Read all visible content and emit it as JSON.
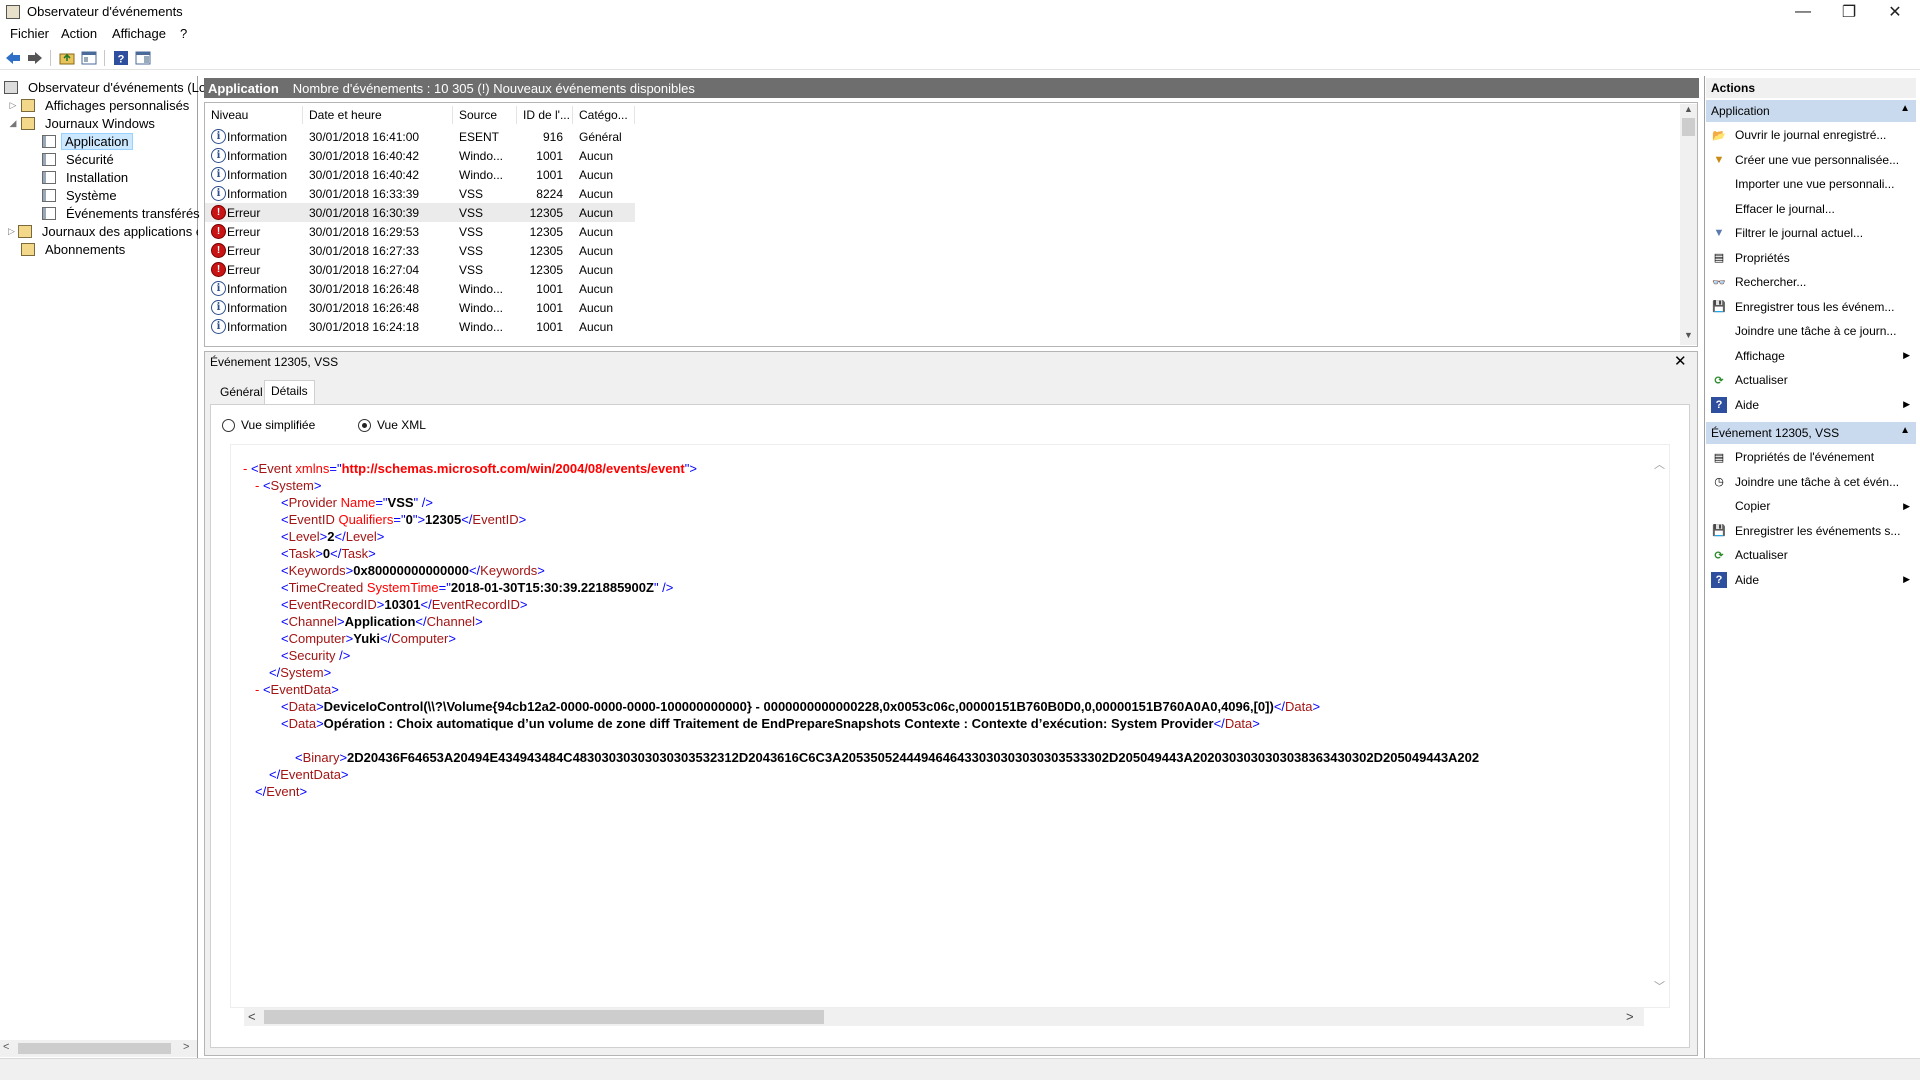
{
  "window": {
    "title": "Observateur d'événements",
    "minimize": "—",
    "maximize": "❐",
    "close": "✕"
  },
  "menu": [
    "Fichier",
    "Action",
    "Affichage",
    "?"
  ],
  "tree": {
    "root": "Observateur d'événements (Local)",
    "custom_views": "Affichages personnalisés",
    "windows_logs": "Journaux Windows",
    "logs": [
      "Application",
      "Sécurité",
      "Installation",
      "Système",
      "Événements transférés"
    ],
    "app_logs": "Journaux des applications et de services",
    "subscriptions": "Abonnements"
  },
  "center_header": {
    "title": "Application",
    "info": "Nombre d'événements : 10 305 (!) Nouveaux événements disponibles"
  },
  "columns": [
    "Niveau",
    "Date et heure",
    "Source",
    "ID de l'...",
    "Catégo..."
  ],
  "events": [
    {
      "level": "Information",
      "type": "info",
      "date": "30/01/2018 16:41:00",
      "source": "ESENT",
      "id": "916",
      "category": "Général"
    },
    {
      "level": "Information",
      "type": "info",
      "date": "30/01/2018 16:40:42",
      "source": "Windo...",
      "id": "1001",
      "category": "Aucun"
    },
    {
      "level": "Information",
      "type": "info",
      "date": "30/01/2018 16:40:42",
      "source": "Windo...",
      "id": "1001",
      "category": "Aucun"
    },
    {
      "level": "Information",
      "type": "info",
      "date": "30/01/2018 16:33:39",
      "source": "VSS",
      "id": "8224",
      "category": "Aucun"
    },
    {
      "level": "Erreur",
      "type": "err",
      "date": "30/01/2018 16:30:39",
      "source": "VSS",
      "id": "12305",
      "category": "Aucun"
    },
    {
      "level": "Erreur",
      "type": "err",
      "date": "30/01/2018 16:29:53",
      "source": "VSS",
      "id": "12305",
      "category": "Aucun"
    },
    {
      "level": "Erreur",
      "type": "err",
      "date": "30/01/2018 16:27:33",
      "source": "VSS",
      "id": "12305",
      "category": "Aucun"
    },
    {
      "level": "Erreur",
      "type": "err",
      "date": "30/01/2018 16:27:04",
      "source": "VSS",
      "id": "12305",
      "category": "Aucun"
    },
    {
      "level": "Information",
      "type": "info",
      "date": "30/01/2018 16:26:48",
      "source": "Windo...",
      "id": "1001",
      "category": "Aucun"
    },
    {
      "level": "Information",
      "type": "info",
      "date": "30/01/2018 16:26:48",
      "source": "Windo...",
      "id": "1001",
      "category": "Aucun"
    },
    {
      "level": "Information",
      "type": "info",
      "date": "30/01/2018 16:24:18",
      "source": "Windo...",
      "id": "1001",
      "category": "Aucun"
    }
  ],
  "detail": {
    "title": "Événement 12305, VSS",
    "tabs": [
      "Général",
      "Détails"
    ],
    "radio_simple": "Vue simplifiée",
    "radio_xml": "Vue XML",
    "xml": {
      "ns": "http://schemas.microsoft.com/win/2004/08/events/event",
      "provider": "VSS",
      "qualifiers": "0",
      "event_id": "12305",
      "level": "2",
      "task": "0",
      "keywords": "0x80000000000000",
      "system_time": "2018-01-30T15:30:39.221885900Z",
      "record_id": "10301",
      "channel": "Application",
      "computer": "Yuki",
      "data1": "DeviceIoControl(\\\\?\\Volume{94cb12a2-0000-0000-0000-100000000000} - 0000000000000228,0x0053c06c,00000151B760B0D0,0,00000151B760A0A0,4096,[0])",
      "data2": "Opération : Choix automatique d’un volume de zone diff Traitement de EndPrepareSnapshots Contexte : Contexte d’exécution: System Provider",
      "binary": "2D20436F64653A20494E434943484C48303030303030303532312D2043616C6C3A2053505244494646433030303030303533302D205049443A2020303030303038363430302D205049443A202"
    }
  },
  "actions": {
    "title": "Actions",
    "section1": "Application",
    "items1": [
      {
        "label": "Ouvrir le journal enregistré...",
        "icon": "open-folder-icon",
        "glyph": "📂",
        "sub": ""
      },
      {
        "label": "Créer une vue personnalisée...",
        "icon": "funnel-icon",
        "glyph": "▼",
        "sub": ""
      },
      {
        "label": "Importer une vue personnali...",
        "icon": "",
        "glyph": "",
        "sub": ""
      },
      {
        "label": "Effacer le journal...",
        "icon": "",
        "glyph": "",
        "sub": ""
      },
      {
        "label": "Filtrer le journal actuel...",
        "icon": "filter-icon",
        "glyph": "▼",
        "sub": ""
      },
      {
        "label": "Propriétés",
        "icon": "properties-icon",
        "glyph": "▤",
        "sub": ""
      },
      {
        "label": "Rechercher...",
        "icon": "binoculars-icon",
        "glyph": "👓",
        "sub": ""
      },
      {
        "label": "Enregistrer tous les événem...",
        "icon": "save-icon",
        "glyph": "💾",
        "sub": ""
      },
      {
        "label": "Joindre une tâche à ce journ...",
        "icon": "",
        "glyph": "",
        "sub": ""
      },
      {
        "label": "Affichage",
        "icon": "",
        "glyph": "",
        "sub": "▶"
      },
      {
        "label": "Actualiser",
        "icon": "refresh-icon",
        "glyph": "⟳",
        "sub": ""
      },
      {
        "label": "Aide",
        "icon": "help-icon",
        "glyph": "?",
        "sub": "▶"
      }
    ],
    "section2": "Événement 12305, VSS",
    "items2": [
      {
        "label": "Propriétés de l'événement",
        "icon": "properties-icon",
        "glyph": "▤",
        "sub": ""
      },
      {
        "label": "Joindre une tâche à cet évén...",
        "icon": "task-icon",
        "glyph": "◷",
        "sub": ""
      },
      {
        "label": "Copier",
        "icon": "copy-icon",
        "glyph": "",
        "sub": "▶"
      },
      {
        "label": "Enregistrer les événements s...",
        "icon": "save-icon",
        "glyph": "💾",
        "sub": ""
      },
      {
        "label": "Actualiser",
        "icon": "refresh-icon",
        "glyph": "⟳",
        "sub": ""
      },
      {
        "label": "Aide",
        "icon": "help-icon",
        "glyph": "?",
        "sub": "▶"
      }
    ]
  },
  "colors": {
    "error": "#c81414",
    "info": "#2b4e8c",
    "section_bg": "#c9d9ee",
    "header_bg": "#6e6e6e"
  }
}
